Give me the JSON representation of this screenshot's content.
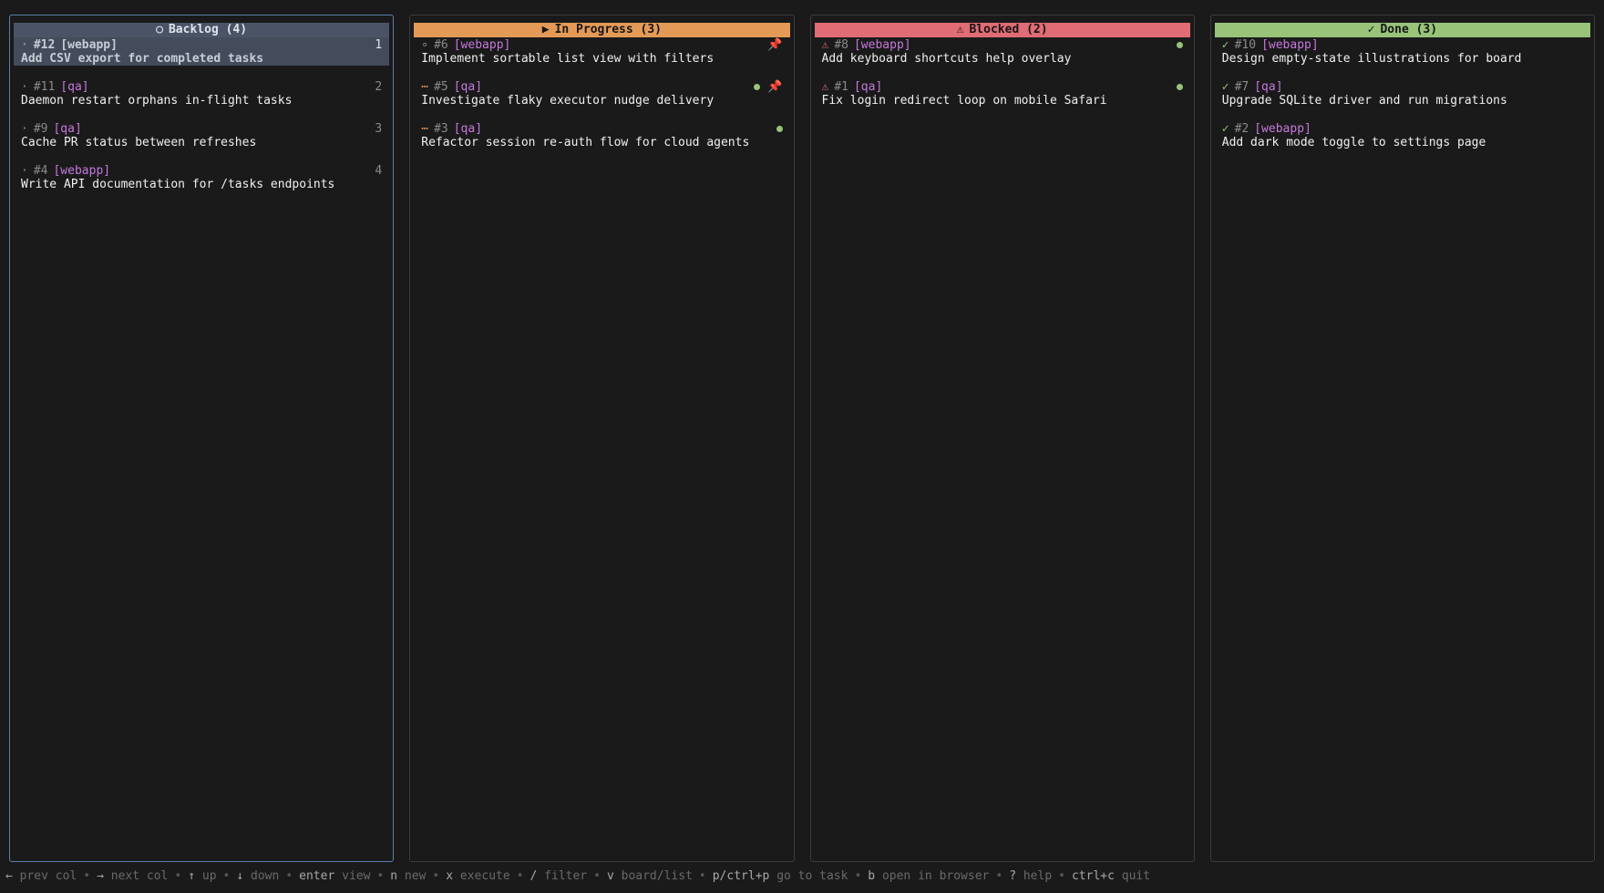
{
  "columns": [
    {
      "id": "backlog",
      "icon": "○",
      "title": "Backlog (4)",
      "cards": [
        {
          "status": "·",
          "id": "#12",
          "tag": "[webapp]",
          "title": "Add CSV export for completed tasks",
          "shortcut": "1",
          "selected": true
        },
        {
          "status": "·",
          "id": "#11",
          "tag": "[qa]",
          "title": "Daemon restart orphans in-flight tasks",
          "shortcut": "2"
        },
        {
          "status": "·",
          "id": "#9",
          "tag": "[qa]",
          "title": "Cache PR status between refreshes",
          "shortcut": "3"
        },
        {
          "status": "·",
          "id": "#4",
          "tag": "[webapp]",
          "title": "Write API documentation for /tasks endpoints",
          "shortcut": "4"
        }
      ]
    },
    {
      "id": "progress",
      "icon": "▶",
      "title": "In Progress (3)",
      "cards": [
        {
          "status": "∘",
          "id": "#6",
          "tag": "[webapp]",
          "title": "Implement sortable list view with filters",
          "pinned": true
        },
        {
          "status": "⋯",
          "id": "#5",
          "tag": "[qa]",
          "title": "Investigate flaky executor nudge delivery",
          "dot": true,
          "pinned": true
        },
        {
          "status": "⋯",
          "id": "#3",
          "tag": "[qa]",
          "title": "Refactor session re-auth flow for cloud agents",
          "dot": true
        }
      ]
    },
    {
      "id": "blocked",
      "icon": "⚠",
      "title": "Blocked (2)",
      "cards": [
        {
          "status": "⚠",
          "id": "#8",
          "tag": "[webapp]",
          "title": "Add keyboard shortcuts help overlay",
          "dot": true
        },
        {
          "status": "⚠",
          "id": "#1",
          "tag": "[qa]",
          "title": "Fix login redirect loop on mobile Safari",
          "dot": true
        }
      ]
    },
    {
      "id": "done",
      "icon": "✓",
      "title": "Done (3)",
      "cards": [
        {
          "status": "✓",
          "id": "#10",
          "tag": "[webapp]",
          "title": "Design empty-state illustrations for board"
        },
        {
          "status": "✓",
          "id": "#7",
          "tag": "[qa]",
          "title": "Upgrade SQLite driver and run migrations"
        },
        {
          "status": "✓",
          "id": "#2",
          "tag": "[webapp]",
          "title": "Add dark mode toggle to settings page"
        }
      ]
    }
  ],
  "footer": [
    {
      "key": "←",
      "label": "prev col"
    },
    {
      "key": "→",
      "label": "next col"
    },
    {
      "key": "↑",
      "label": "up"
    },
    {
      "key": "↓",
      "label": "down"
    },
    {
      "key": "enter",
      "label": "view"
    },
    {
      "key": "n",
      "label": "new"
    },
    {
      "key": "x",
      "label": "execute"
    },
    {
      "key": "/",
      "label": "filter"
    },
    {
      "key": "v",
      "label": "board/list"
    },
    {
      "key": "p/ctrl+p",
      "label": "go to task"
    },
    {
      "key": "b",
      "label": "open in browser"
    },
    {
      "key": "?",
      "label": "help"
    },
    {
      "key": "ctrl+c",
      "label": "quit"
    }
  ],
  "icons": {
    "pin": "pin-icon",
    "dot": "running-indicator-icon"
  },
  "colors": {
    "backlog": "#4a5466",
    "in_progress": "#e49a57",
    "blocked": "#e06c75",
    "done": "#98c379",
    "tag": "#c678dd",
    "active_border": "#5a7dab"
  }
}
